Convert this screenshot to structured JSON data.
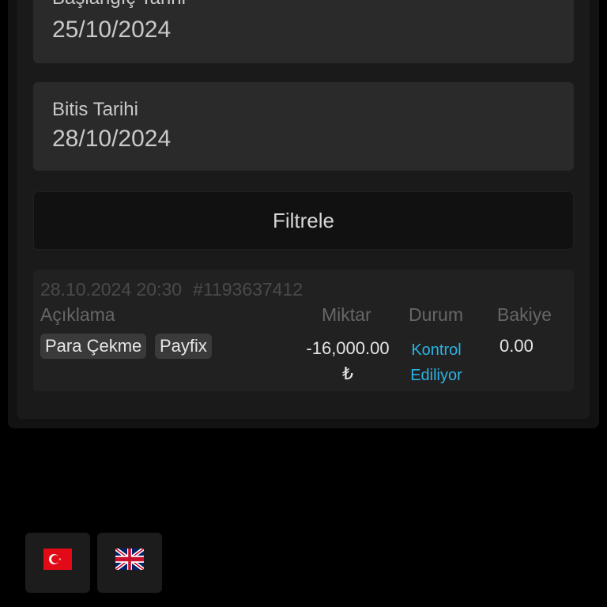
{
  "filters": {
    "start_date": {
      "label": "Başlangıç Tarihi",
      "value": "25/10/2024"
    },
    "end_date": {
      "label": "Bitis Tarihi",
      "value": "28/10/2024"
    },
    "filter_button": "Filtrele"
  },
  "transaction": {
    "datetime": "28.10.2024 20:30",
    "id": "#1193637412",
    "headers": {
      "description": "Açıklama",
      "amount": "Miktar",
      "status": "Durum",
      "balance": "Bakiye"
    },
    "tags": [
      "Para Çekme",
      "Payfix"
    ],
    "amount": "-16,000.00",
    "currency": "₺",
    "status": "Kontrol Ediliyor",
    "balance": "0.00"
  },
  "colors": {
    "background": "#000000",
    "card": "#2a2a2a",
    "status_accent": "#2bb3e6"
  },
  "languages": [
    {
      "code": "tr",
      "icon": "turkey-flag-icon"
    },
    {
      "code": "en",
      "icon": "uk-flag-icon"
    }
  ]
}
